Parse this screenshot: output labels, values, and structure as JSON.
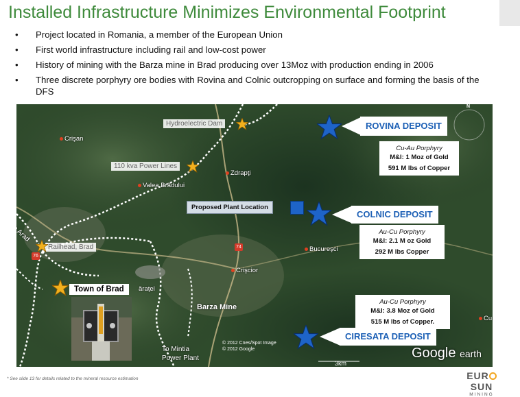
{
  "title": "Installed Infrastructure Minimizes Environmental Footprint",
  "bullets": [
    "Project located in Romania, a member of the European Union",
    "First world infrastructure including rail and low-cost power",
    "History of mining with the Barza mine in Brad producing over 13Moz with production ending in 2006",
    "Three discrete porphyry ore bodies with Rovina and Colnic outcropping on surface and forming the basis of the DFS"
  ],
  "bullet_char": "•",
  "map": {
    "towns": {
      "crisan": "Crişan",
      "zdrapti": "Zdrapţi",
      "valea": "Valea Brădului",
      "bucuresci": "Bucureşci",
      "criscior": "Crişcior",
      "brad_partial": "ăraţel",
      "edge_partial": "Cu"
    },
    "infrastructure": {
      "hydro": "Hydroelectric Dam",
      "power_lines": "110 kva Power Lines",
      "railhead": "Railhead, Brad",
      "to_arad": "To Arad",
      "to_mintia": "To Mintia\nPower Plant",
      "plant": "Proposed Plant Location",
      "barza_mine": "Barza Mine",
      "town_of_brad": "Town of Brad"
    },
    "road_numbers": {
      "r74": "74",
      "r76": "76"
    },
    "deposits": [
      {
        "name": "ROVINA DEPOSIT",
        "type": "Cu-Au Porphyry",
        "line1": "M&I: 1 Moz of Gold",
        "line2": "591 M lbs of Copper"
      },
      {
        "name": "COLNIC DEPOSIT",
        "type": "Au-Cu Porphyry",
        "line1": "M&I: 2.1 M oz Gold",
        "line2": "292 M lbs Copper"
      },
      {
        "name": "CIRESATA DEPOSIT",
        "type": "Au-Cu Porphyry",
        "line1": "M&I: 3.8 Moz of Gold",
        "line2": "515 M lbs of Copper."
      }
    ],
    "copyright": "© 2012 Cnes/Spot Image\n© 2012 Google",
    "google_earth": {
      "google": "Google",
      "earth": "earth"
    },
    "scale": "3km",
    "north": "N"
  },
  "footnote": "* See slide 13 for details related to the mineral resource estimation",
  "logo": {
    "name_pre": "EUR",
    "name_post": "SUN",
    "sub": "MINING"
  },
  "colors": {
    "title": "#3e8a3b",
    "deposit": "#1b5fb5",
    "star_blue": "#1e64c8",
    "star_yellow": "#f2b01e"
  }
}
